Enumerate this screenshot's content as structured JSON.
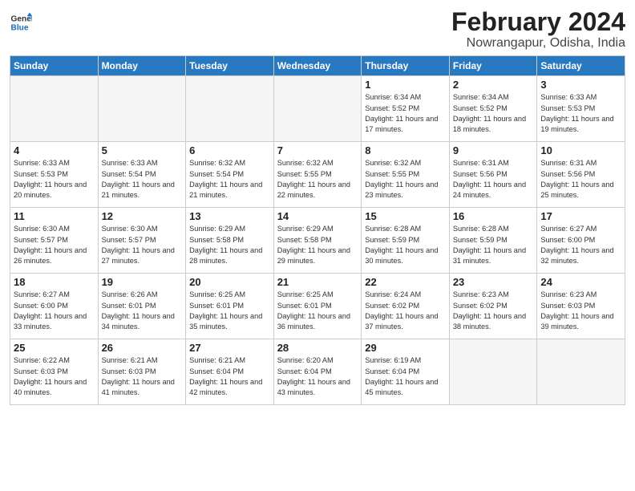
{
  "logo": {
    "line1": "General",
    "line2": "Blue"
  },
  "title": {
    "month_year": "February 2024",
    "location": "Nowrangapur, Odisha, India"
  },
  "days_of_week": [
    "Sunday",
    "Monday",
    "Tuesday",
    "Wednesday",
    "Thursday",
    "Friday",
    "Saturday"
  ],
  "weeks": [
    [
      {
        "day": "",
        "empty": true
      },
      {
        "day": "",
        "empty": true
      },
      {
        "day": "",
        "empty": true
      },
      {
        "day": "",
        "empty": true
      },
      {
        "day": "1",
        "sunrise": "6:34 AM",
        "sunset": "5:52 PM",
        "daylight": "11 hours and 17 minutes."
      },
      {
        "day": "2",
        "sunrise": "6:34 AM",
        "sunset": "5:52 PM",
        "daylight": "11 hours and 18 minutes."
      },
      {
        "day": "3",
        "sunrise": "6:33 AM",
        "sunset": "5:53 PM",
        "daylight": "11 hours and 19 minutes."
      }
    ],
    [
      {
        "day": "4",
        "sunrise": "6:33 AM",
        "sunset": "5:53 PM",
        "daylight": "11 hours and 20 minutes."
      },
      {
        "day": "5",
        "sunrise": "6:33 AM",
        "sunset": "5:54 PM",
        "daylight": "11 hours and 21 minutes."
      },
      {
        "day": "6",
        "sunrise": "6:32 AM",
        "sunset": "5:54 PM",
        "daylight": "11 hours and 21 minutes."
      },
      {
        "day": "7",
        "sunrise": "6:32 AM",
        "sunset": "5:55 PM",
        "daylight": "11 hours and 22 minutes."
      },
      {
        "day": "8",
        "sunrise": "6:32 AM",
        "sunset": "5:55 PM",
        "daylight": "11 hours and 23 minutes."
      },
      {
        "day": "9",
        "sunrise": "6:31 AM",
        "sunset": "5:56 PM",
        "daylight": "11 hours and 24 minutes."
      },
      {
        "day": "10",
        "sunrise": "6:31 AM",
        "sunset": "5:56 PM",
        "daylight": "11 hours and 25 minutes."
      }
    ],
    [
      {
        "day": "11",
        "sunrise": "6:30 AM",
        "sunset": "5:57 PM",
        "daylight": "11 hours and 26 minutes."
      },
      {
        "day": "12",
        "sunrise": "6:30 AM",
        "sunset": "5:57 PM",
        "daylight": "11 hours and 27 minutes."
      },
      {
        "day": "13",
        "sunrise": "6:29 AM",
        "sunset": "5:58 PM",
        "daylight": "11 hours and 28 minutes."
      },
      {
        "day": "14",
        "sunrise": "6:29 AM",
        "sunset": "5:58 PM",
        "daylight": "11 hours and 29 minutes."
      },
      {
        "day": "15",
        "sunrise": "6:28 AM",
        "sunset": "5:59 PM",
        "daylight": "11 hours and 30 minutes."
      },
      {
        "day": "16",
        "sunrise": "6:28 AM",
        "sunset": "5:59 PM",
        "daylight": "11 hours and 31 minutes."
      },
      {
        "day": "17",
        "sunrise": "6:27 AM",
        "sunset": "6:00 PM",
        "daylight": "11 hours and 32 minutes."
      }
    ],
    [
      {
        "day": "18",
        "sunrise": "6:27 AM",
        "sunset": "6:00 PM",
        "daylight": "11 hours and 33 minutes."
      },
      {
        "day": "19",
        "sunrise": "6:26 AM",
        "sunset": "6:01 PM",
        "daylight": "11 hours and 34 minutes."
      },
      {
        "day": "20",
        "sunrise": "6:25 AM",
        "sunset": "6:01 PM",
        "daylight": "11 hours and 35 minutes."
      },
      {
        "day": "21",
        "sunrise": "6:25 AM",
        "sunset": "6:01 PM",
        "daylight": "11 hours and 36 minutes."
      },
      {
        "day": "22",
        "sunrise": "6:24 AM",
        "sunset": "6:02 PM",
        "daylight": "11 hours and 37 minutes."
      },
      {
        "day": "23",
        "sunrise": "6:23 AM",
        "sunset": "6:02 PM",
        "daylight": "11 hours and 38 minutes."
      },
      {
        "day": "24",
        "sunrise": "6:23 AM",
        "sunset": "6:03 PM",
        "daylight": "11 hours and 39 minutes."
      }
    ],
    [
      {
        "day": "25",
        "sunrise": "6:22 AM",
        "sunset": "6:03 PM",
        "daylight": "11 hours and 40 minutes."
      },
      {
        "day": "26",
        "sunrise": "6:21 AM",
        "sunset": "6:03 PM",
        "daylight": "11 hours and 41 minutes."
      },
      {
        "day": "27",
        "sunrise": "6:21 AM",
        "sunset": "6:04 PM",
        "daylight": "11 hours and 42 minutes."
      },
      {
        "day": "28",
        "sunrise": "6:20 AM",
        "sunset": "6:04 PM",
        "daylight": "11 hours and 43 minutes."
      },
      {
        "day": "29",
        "sunrise": "6:19 AM",
        "sunset": "6:04 PM",
        "daylight": "11 hours and 45 minutes."
      },
      {
        "day": "",
        "empty": true
      },
      {
        "day": "",
        "empty": true
      }
    ]
  ]
}
